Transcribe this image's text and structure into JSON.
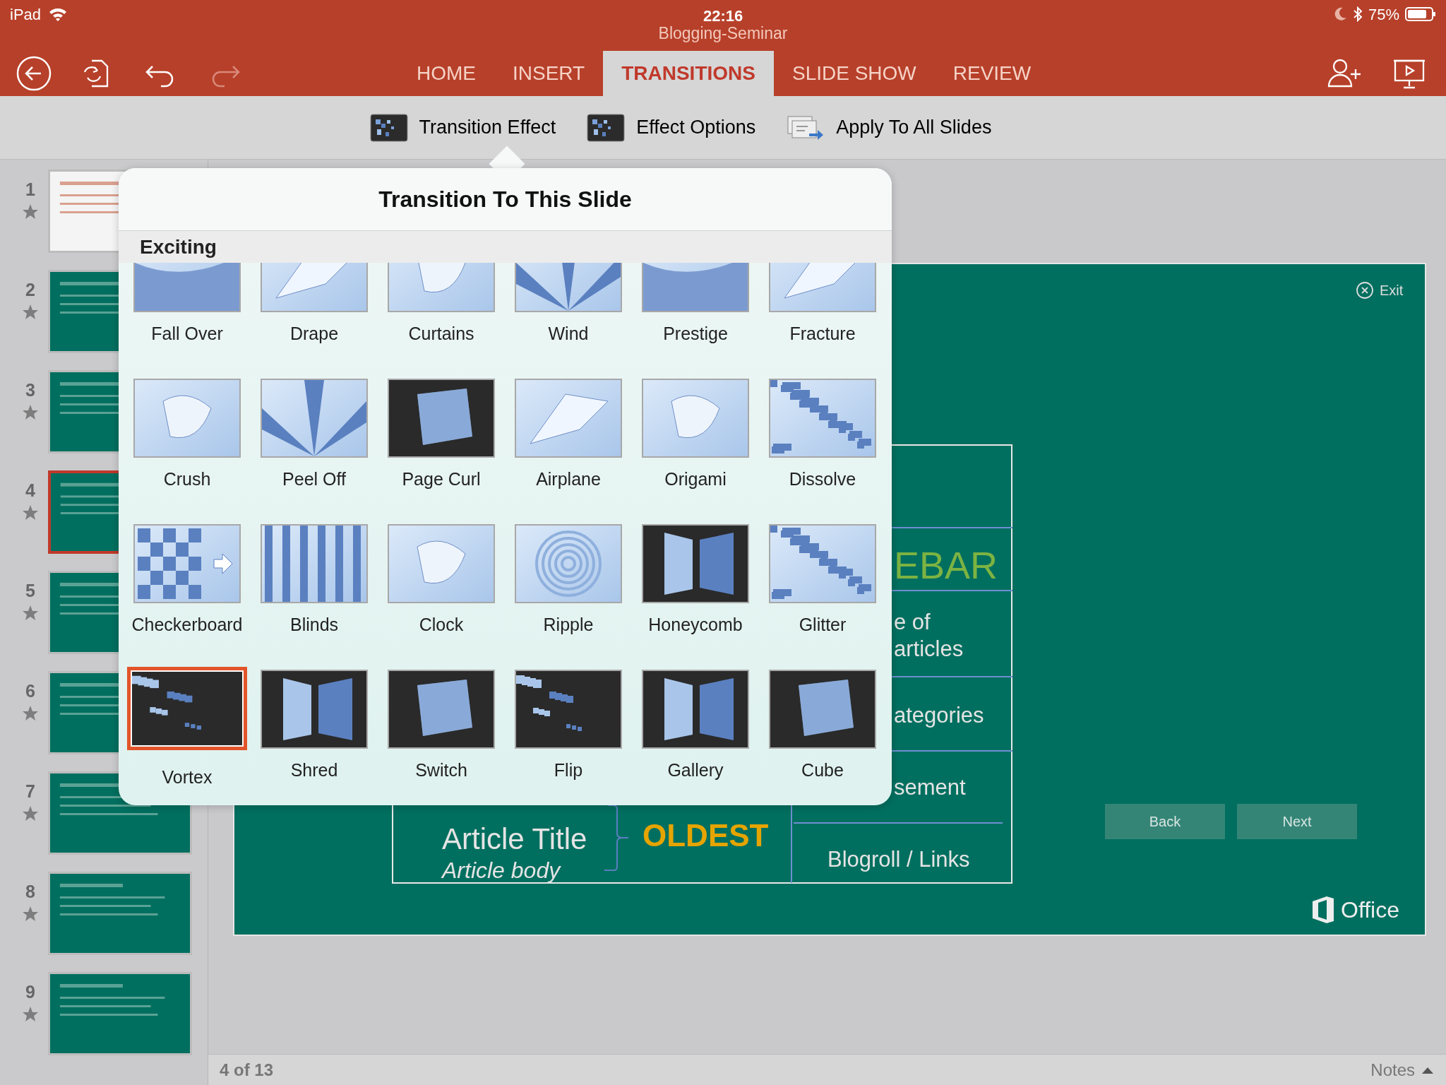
{
  "status_bar": {
    "device": "iPad",
    "time": "22:16",
    "battery": "75%"
  },
  "document_title": "Blogging-Seminar",
  "tabs": [
    {
      "label": "HOME",
      "selected": false
    },
    {
      "label": "INSERT",
      "selected": false
    },
    {
      "label": "TRANSITIONS",
      "selected": true
    },
    {
      "label": "SLIDE SHOW",
      "selected": false
    },
    {
      "label": "REVIEW",
      "selected": false
    }
  ],
  "ribbon": [
    {
      "label": "Transition Effect",
      "kind": "effect"
    },
    {
      "label": "Effect Options",
      "kind": "effect"
    },
    {
      "label": "Apply To All Slides",
      "kind": "apply"
    }
  ],
  "slides": [
    {
      "number": "1",
      "selected": false,
      "kind": "title"
    },
    {
      "number": "2",
      "selected": false,
      "kind": "content"
    },
    {
      "number": "3",
      "selected": false,
      "kind": "content"
    },
    {
      "number": "4",
      "selected": true,
      "kind": "content"
    },
    {
      "number": "5",
      "selected": false,
      "kind": "content"
    },
    {
      "number": "6",
      "selected": false,
      "kind": "content"
    },
    {
      "number": "7",
      "selected": false,
      "kind": "content"
    },
    {
      "number": "8",
      "selected": false,
      "kind": "content"
    },
    {
      "number": "9",
      "selected": false,
      "kind": "content"
    }
  ],
  "popover": {
    "title": "Transition To This Slide",
    "section": "Exciting",
    "transitions": [
      {
        "label": "Fall Over",
        "selected": false,
        "kind": "light"
      },
      {
        "label": "Drape",
        "selected": false,
        "kind": "light"
      },
      {
        "label": "Curtains",
        "selected": false,
        "kind": "light"
      },
      {
        "label": "Wind",
        "selected": false,
        "kind": "light"
      },
      {
        "label": "Prestige",
        "selected": false,
        "kind": "light"
      },
      {
        "label": "Fracture",
        "selected": false,
        "kind": "light"
      },
      {
        "label": "Crush",
        "selected": false,
        "kind": "light"
      },
      {
        "label": "Peel Off",
        "selected": false,
        "kind": "light"
      },
      {
        "label": "Page Curl",
        "selected": false,
        "kind": "dark"
      },
      {
        "label": "Airplane",
        "selected": false,
        "kind": "light"
      },
      {
        "label": "Origami",
        "selected": false,
        "kind": "light"
      },
      {
        "label": "Dissolve",
        "selected": false,
        "kind": "pattern"
      },
      {
        "label": "Checkerboard",
        "selected": false,
        "kind": "checker"
      },
      {
        "label": "Blinds",
        "selected": false,
        "kind": "stripes"
      },
      {
        "label": "Clock",
        "selected": false,
        "kind": "light"
      },
      {
        "label": "Ripple",
        "selected": false,
        "kind": "ripple"
      },
      {
        "label": "Honeycomb",
        "selected": false,
        "kind": "dark"
      },
      {
        "label": "Glitter",
        "selected": false,
        "kind": "pattern"
      },
      {
        "label": "Vortex",
        "selected": true,
        "kind": "dark"
      },
      {
        "label": "Shred",
        "selected": false,
        "kind": "dark"
      },
      {
        "label": "Switch",
        "selected": false,
        "kind": "dark"
      },
      {
        "label": "Flip",
        "selected": false,
        "kind": "dark"
      },
      {
        "label": "Gallery",
        "selected": false,
        "kind": "dark"
      },
      {
        "label": "Cube",
        "selected": false,
        "kind": "dark"
      }
    ]
  },
  "slide": {
    "exit": "Exit",
    "sidebar_heading": "EBAR",
    "sidebar_lines": [
      "e of",
      "articles",
      "ategories",
      "sement"
    ],
    "blogroll": "Blogroll / Links",
    "article_title": "Article Title",
    "article_body": "Article body",
    "age_label": "OLDEST",
    "buttons": [
      "Back",
      "Next"
    ],
    "logo": "Office"
  },
  "footer": {
    "position": "4 of 13",
    "notes": "Notes"
  }
}
